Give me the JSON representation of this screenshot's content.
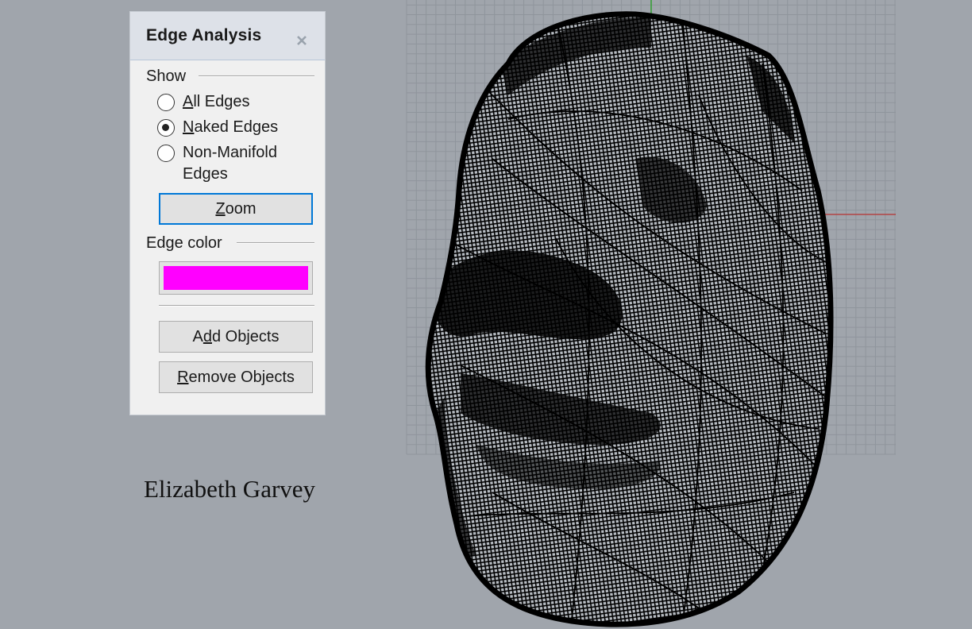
{
  "dialog": {
    "title": "Edge Analysis",
    "close_icon": "close-icon",
    "show_group": {
      "label": "Show",
      "options": [
        {
          "prefix": "",
          "mnemonic": "A",
          "rest": "ll Edges",
          "selected": false
        },
        {
          "prefix": "",
          "mnemonic": "N",
          "rest": "aked Edges",
          "selected": true
        },
        {
          "prefix": "",
          "mnemonic": "",
          "rest": "Non-Manifold",
          "line2": "Edges",
          "selected": false
        }
      ]
    },
    "zoom_button": {
      "mnemonic": "Z",
      "rest": "oom"
    },
    "edge_color_group": {
      "label": "Edge color",
      "color": "#ff00ff"
    },
    "add_objects_button": {
      "prefix": "A",
      "mnemonic": "d",
      "rest": "d Objects"
    },
    "remove_objects_button": {
      "mnemonic": "R",
      "rest": "emove Objects"
    }
  },
  "viewport": {
    "background": "#a0a5ac",
    "grid_color": "#8f959c",
    "x_axis_color": "#b24444",
    "y_axis_color": "#33a033",
    "mesh_color": "#000000",
    "object": "wireframe-mesh-face"
  },
  "signature": "Elizabeth Garvey"
}
